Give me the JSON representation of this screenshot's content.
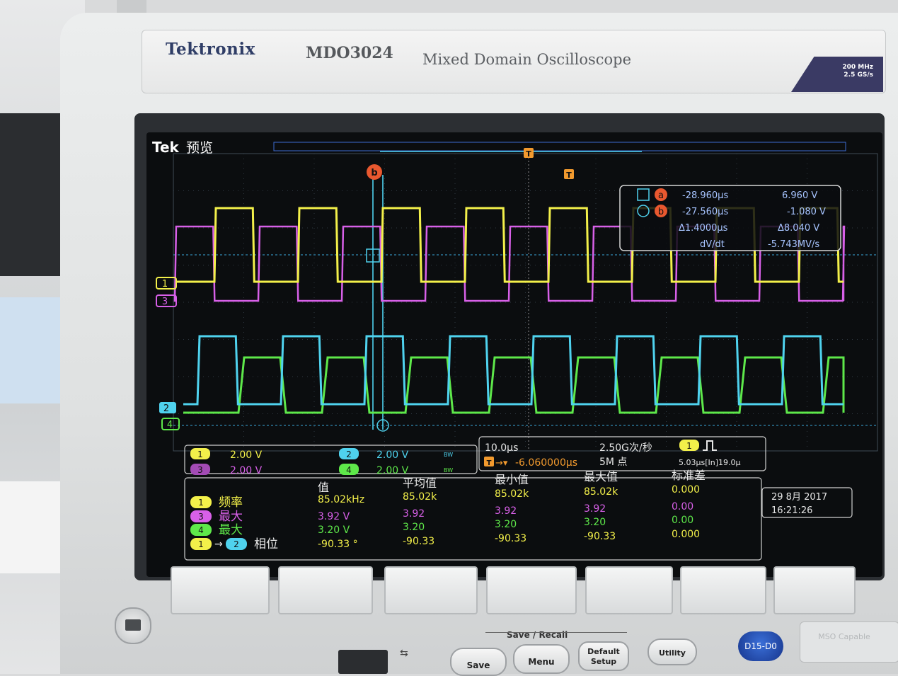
{
  "device": {
    "brand": "Tektronix",
    "model": "MDO3024",
    "model_name": "Mixed Domain Oscilloscope",
    "spec_bandwidth": "200 MHz",
    "spec_sample": "2.5 GS/s"
  },
  "screen": {
    "logo": "Tek",
    "mode": "预览",
    "cursor_a_label": "a",
    "cursor_b_label": "b",
    "cursor_b_marker": "b",
    "trigger_marker": "T",
    "cursor_readout": {
      "a_time": "-28.960μs",
      "a_volt": "6.960 V",
      "b_time": "-27.560μs",
      "b_volt": "-1.080 V",
      "delta_time": "Δ1.4000μs",
      "delta_volt": "Δ8.040 V",
      "dvdt_label": "dV/dt",
      "dvdt_value": "-5.743MV/s"
    },
    "channel_markers": [
      "1",
      "3",
      "2",
      "4"
    ],
    "channels": [
      {
        "id": "1",
        "scale": "2.00 V",
        "color": "#f3f04a"
      },
      {
        "id": "2",
        "scale": "2.00 V",
        "color": "#4fd2ee",
        "bw": "BW"
      },
      {
        "id": "3",
        "scale": "2.00 V",
        "color": "#d860e8"
      },
      {
        "id": "4",
        "scale": "2.00 V",
        "color": "#5ee84a",
        "bw": "BW"
      }
    ],
    "timebase": {
      "scale": "10.0μs",
      "delay": "-6.060000μs",
      "sample_rate": "2.50G次/秒",
      "record_length": "5M 点",
      "trigger_ch": "1",
      "trigger_info": "5.03μs[In]19.0μ"
    },
    "measurements": {
      "headers": [
        "值",
        "平均值",
        "最小值",
        "最大值",
        "标准差"
      ],
      "rows": [
        {
          "ch": "1",
          "label": "频率",
          "color": "#f3f04a",
          "values": [
            "85.02kHz",
            "85.02k",
            "85.02k",
            "85.02k",
            "0.000"
          ]
        },
        {
          "ch": "3",
          "label": "最大",
          "color": "#d860e8",
          "values": [
            "3.92 V",
            "3.92",
            "3.92",
            "3.92",
            "0.00"
          ]
        },
        {
          "ch": "4",
          "label": "最大",
          "color": "#5ee84a",
          "values": [
            "3.20 V",
            "3.20",
            "3.20",
            "3.20",
            "0.00"
          ]
        },
        {
          "ch": "1",
          "ch2": "2",
          "label": "相位",
          "color": "#f3f04a",
          "values": [
            "-90.33 °",
            "-90.33",
            "-90.33",
            "-90.33",
            "0.000"
          ]
        }
      ]
    },
    "datetime": {
      "date": "29 8月 2017",
      "time": "16:21:26"
    }
  },
  "panel": {
    "save_recall_label": "Save / Recall",
    "save_label": "Save",
    "menu_label": "Menu",
    "default_setup_label": "Default Setup",
    "utility_label": "Utility",
    "d15_label": "D15-D0",
    "mso_label": "MSO Capable"
  }
}
